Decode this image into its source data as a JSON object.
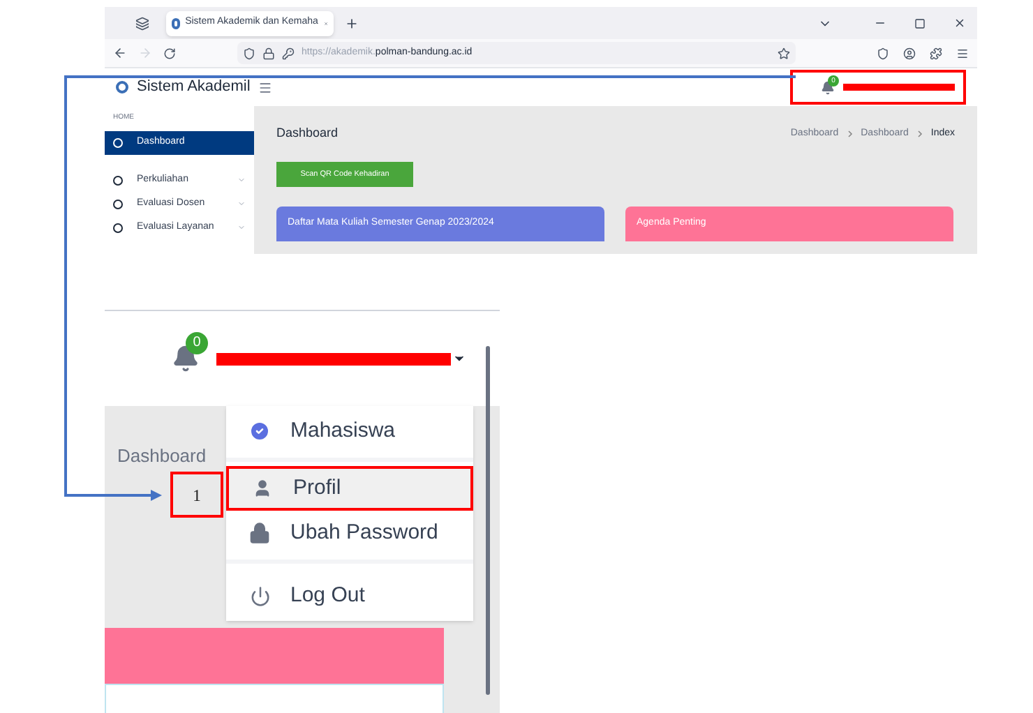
{
  "browser": {
    "tab_title": "Sistem Akademik dan Kemaha",
    "url_prefix": "https://akademik.",
    "url_domain": "polman-bandung.ac.id"
  },
  "app": {
    "title": "Sistem Akademil",
    "notification_count": "0"
  },
  "sidebar": {
    "section": "HOME",
    "items": [
      {
        "label": "Dashboard",
        "selected": true,
        "has_submenu": false
      },
      {
        "label": "Perkuliahan",
        "selected": false,
        "has_submenu": true
      },
      {
        "label": "Evaluasi Dosen",
        "selected": false,
        "has_submenu": true
      },
      {
        "label": "Evaluasi Layanan",
        "selected": false,
        "has_submenu": true
      }
    ]
  },
  "content": {
    "heading": "Dashboard",
    "breadcrumb": [
      "Dashboard",
      "Dashboard",
      "Index"
    ],
    "scan_button": "Scan QR Code Kehadiran",
    "cards": [
      {
        "title": "Daftar Mata Kuliah Semester Genap 2023/2024",
        "color": "#6a7ade"
      },
      {
        "title": "Agenda Penting",
        "color": "#fe7396"
      }
    ]
  },
  "zoom_inset": {
    "notification_count": "0",
    "page_heading": "Dashboard",
    "callout": "1",
    "menu": [
      {
        "kind": "role",
        "label": "Mahasiswa",
        "selected": false
      },
      {
        "kind": "profile",
        "label": "Profil",
        "selected": true
      },
      {
        "kind": "password",
        "label": "Ubah Password",
        "selected": false
      },
      {
        "kind": "logout",
        "label": "Log Out",
        "selected": false
      }
    ]
  }
}
